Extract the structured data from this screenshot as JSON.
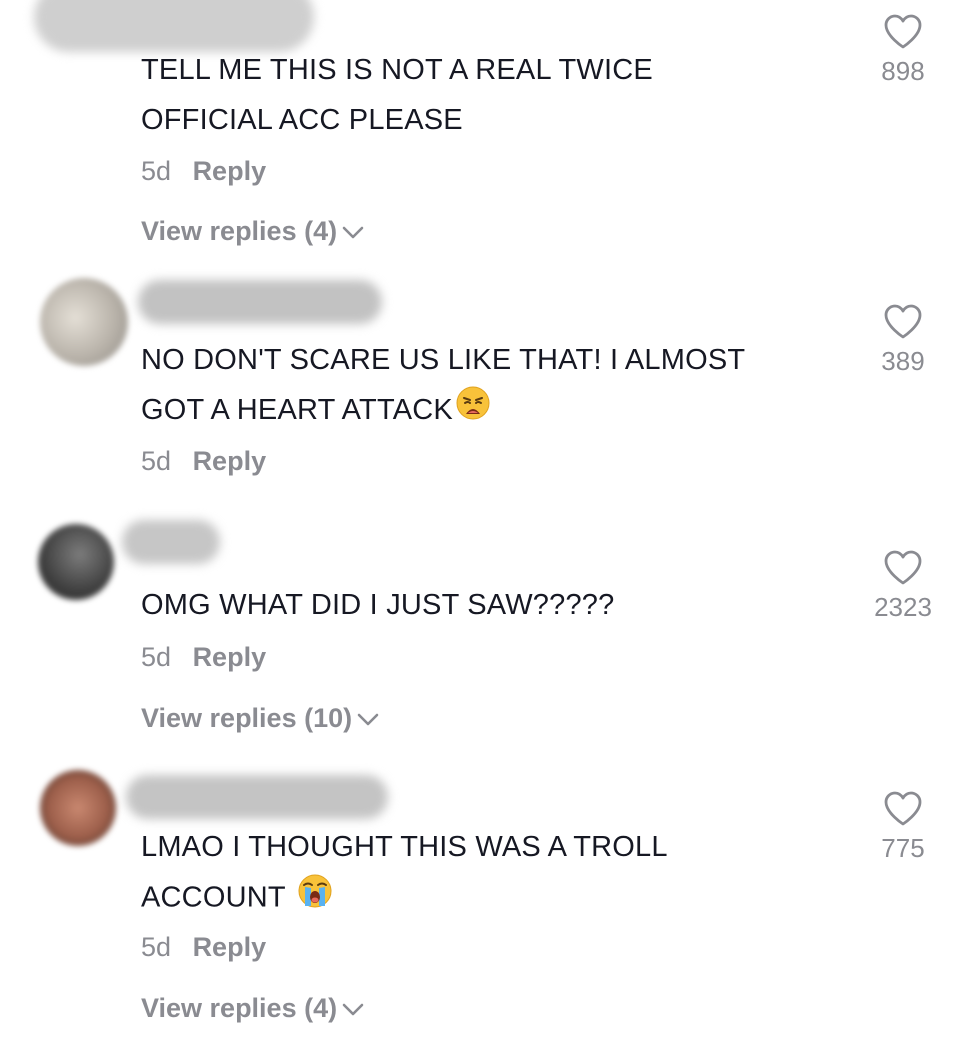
{
  "comments": [
    {
      "text_lines": [
        "TELL ME THIS IS NOT A REAL TWICE",
        "OFFICIAL ACC PLEASE"
      ],
      "emoji": "",
      "time": "5d",
      "reply_label": "Reply",
      "view_replies": "View replies (4)",
      "likes": "898"
    },
    {
      "text_lines": [
        "NO DON'T SCARE US LIKE THAT! I ALMOST",
        "GOT A HEART ATTACK"
      ],
      "emoji": "😩",
      "time": "5d",
      "reply_label": "Reply",
      "view_replies": "",
      "likes": "389"
    },
    {
      "text_lines": [
        "OMG WHAT DID I JUST SAW?????"
      ],
      "emoji": "",
      "time": "5d",
      "reply_label": "Reply",
      "view_replies": "View replies (10)",
      "likes": "2323"
    },
    {
      "text_lines": [
        "LMAO I THOUGHT THIS WAS A TROLL",
        "ACCOUNT"
      ],
      "emoji": "😭",
      "time": "5d",
      "reply_label": "Reply",
      "view_replies": "View replies (4)",
      "likes": "775"
    }
  ],
  "icons": {
    "like": "heart-outline-icon",
    "expand": "chevron-down-icon"
  },
  "colors": {
    "text": "#161823",
    "secondary": "#8a8b91"
  }
}
